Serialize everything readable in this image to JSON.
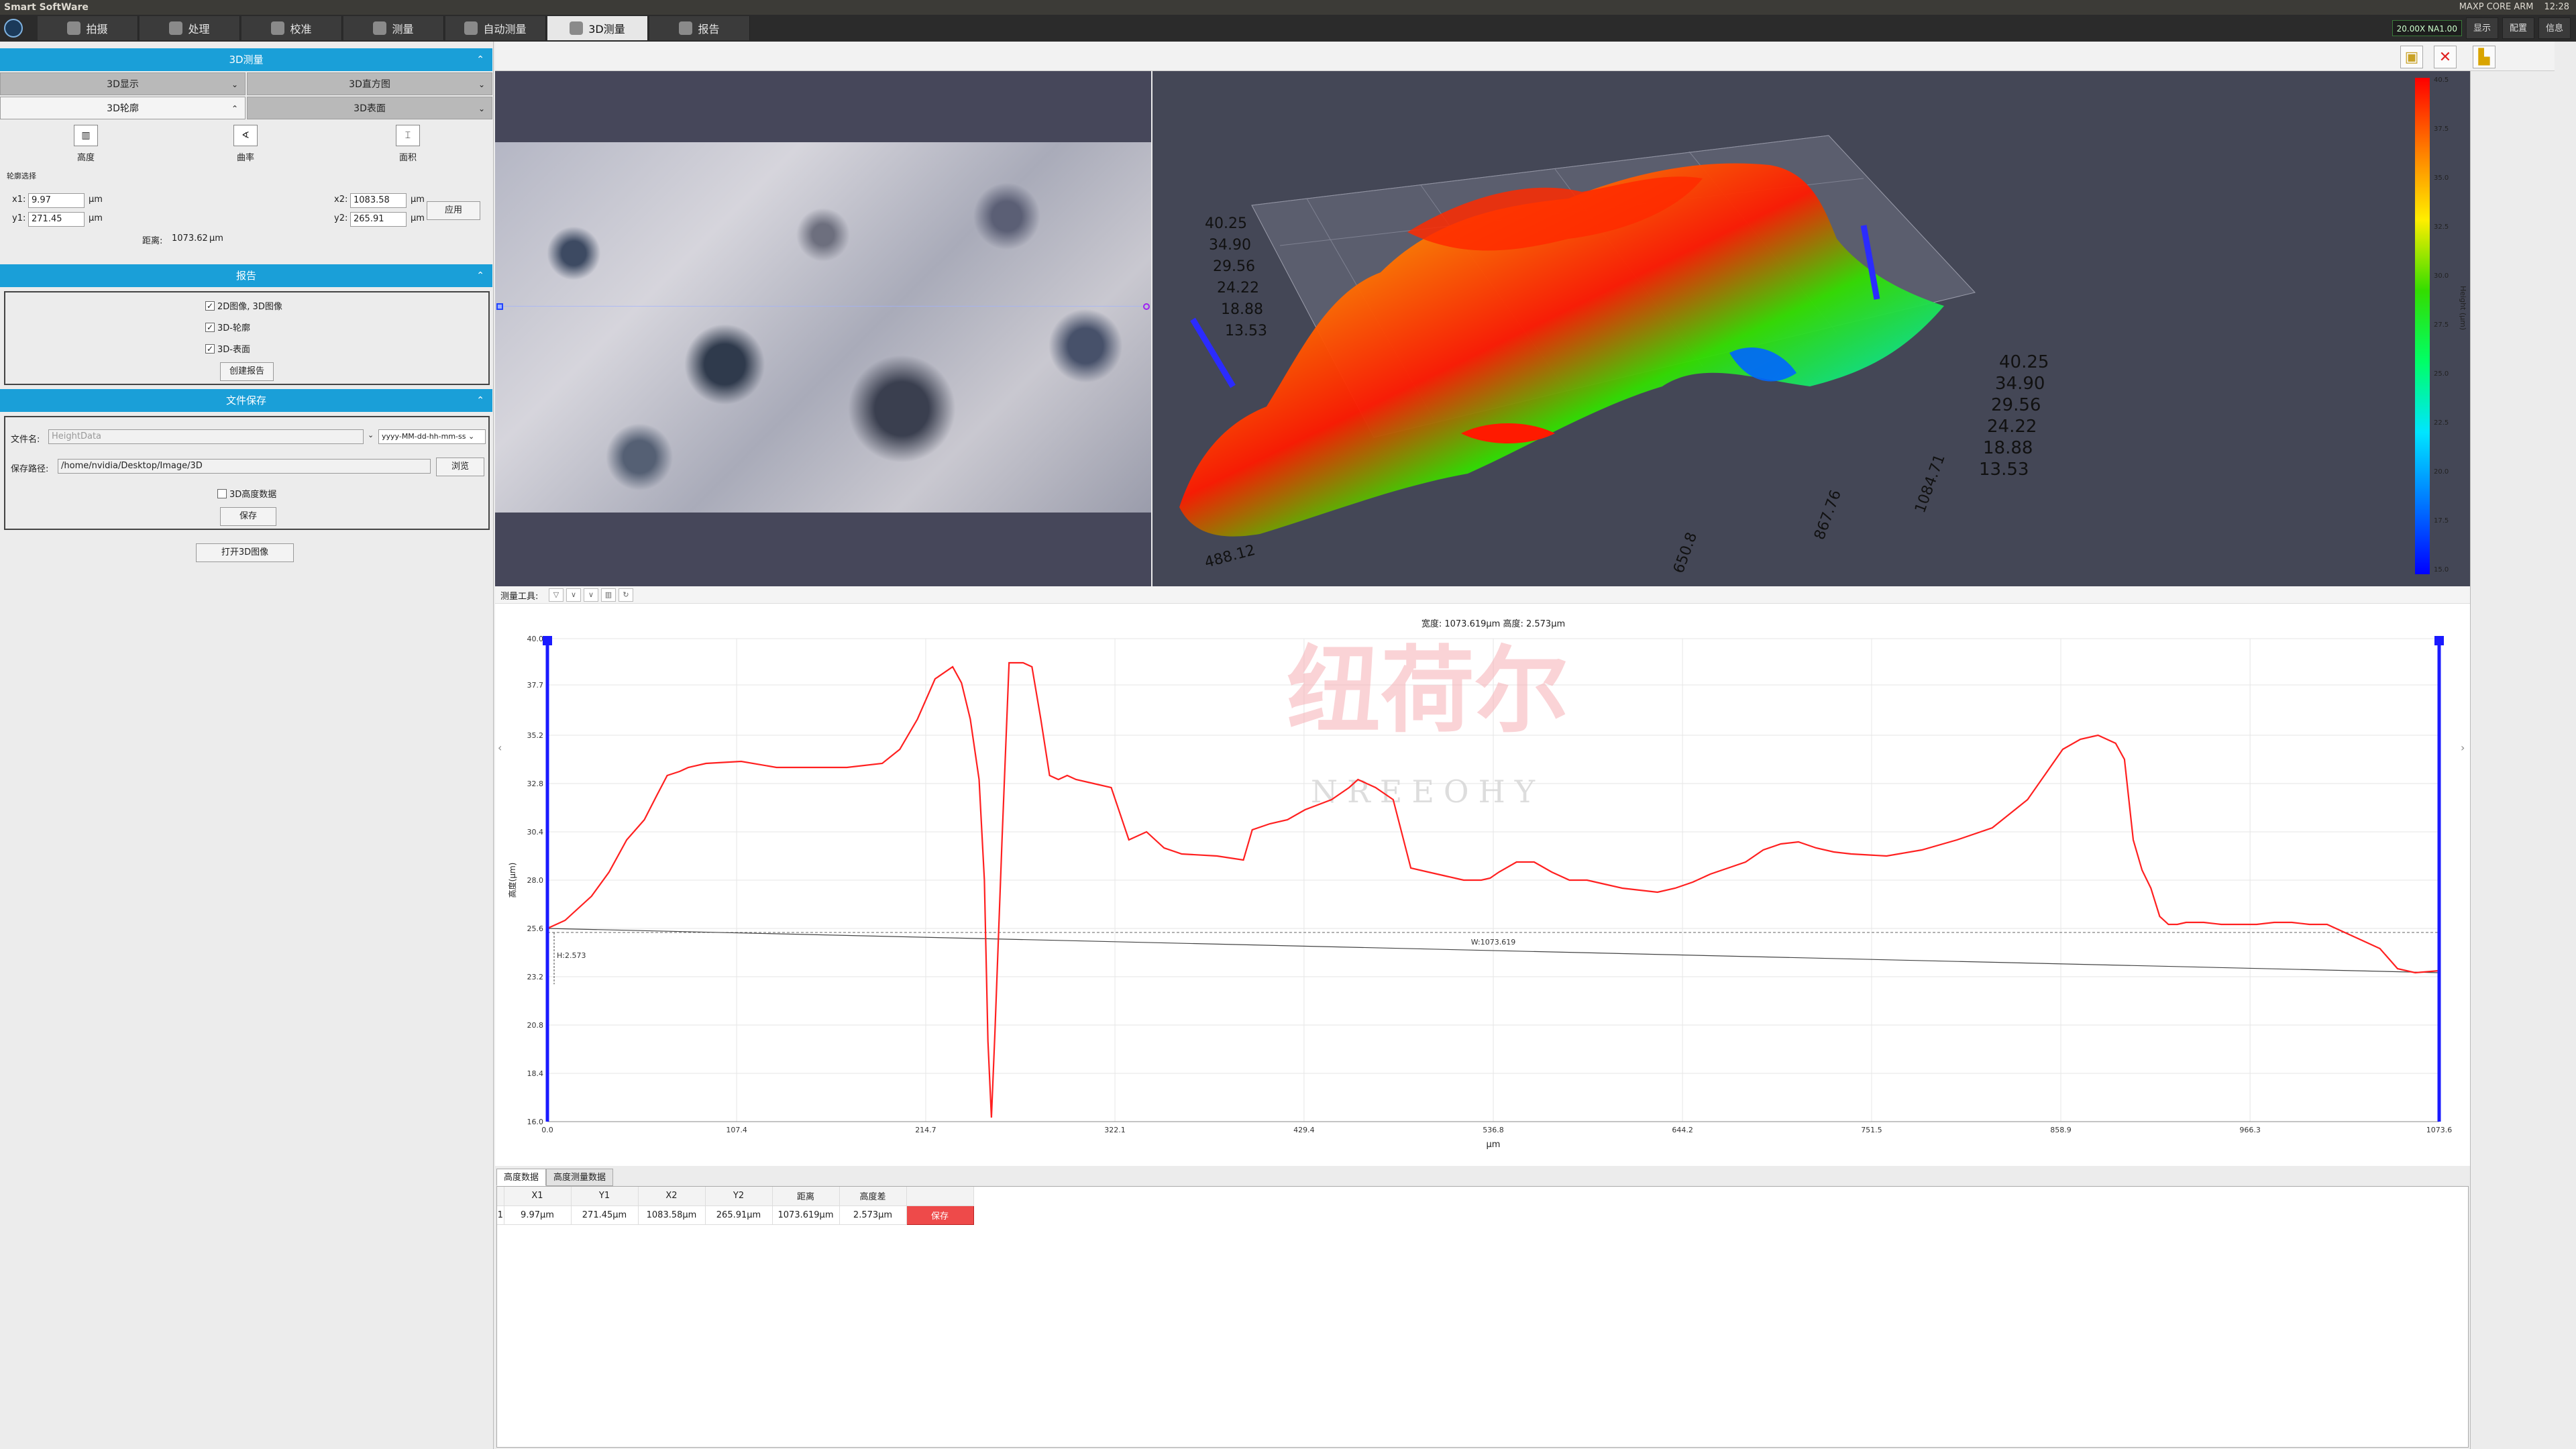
{
  "system_bar": {
    "app_title": "Smart SoftWare",
    "gpu_label": "MAXP CORE ARM",
    "time": "12:28"
  },
  "tabs": [
    {
      "label": "拍摄",
      "icon": "camera-icon"
    },
    {
      "label": "处理",
      "icon": "image-process-icon"
    },
    {
      "label": "校准",
      "icon": "calibrate-icon"
    },
    {
      "label": "测量",
      "icon": "measure-icon"
    },
    {
      "label": "自动测量",
      "icon": "auto-measure-icon"
    },
    {
      "label": "3D测量",
      "icon": "3d-measure-icon"
    },
    {
      "label": "报告",
      "icon": "report-icon"
    }
  ],
  "active_tab": "3D测量",
  "tab_right": {
    "zoom_badge": "20.00X",
    "zoom_badge_2": "NA1.00",
    "display_label": "显示",
    "config_label": "配置",
    "info_label": "信息"
  },
  "left": {
    "measure3d": {
      "header": "3D测量",
      "buttons": [
        "3D显示",
        "3D直方图",
        "3D轮廓",
        "3D表面"
      ],
      "tools": [
        {
          "label": "高度",
          "icon": "height-icon"
        },
        {
          "label": "曲率",
          "icon": "curvature-icon"
        },
        {
          "label": "面积",
          "icon": "area-icon"
        }
      ],
      "contour_select": "轮廓选择",
      "x1_label": "x1:",
      "x1_value": "9.97",
      "y1_label": "y1:",
      "y1_value": "271.45",
      "x2_label": "x2:",
      "x2_value": "1083.58",
      "y2_label": "y2:",
      "y2_value": "265.91",
      "unit": "µm",
      "apply_label": "应用",
      "distance_label": "距离:",
      "distance_value": "1073.62",
      "distance_unit": "µm"
    },
    "report": {
      "header": "报告",
      "checks": [
        {
          "label": "2D图像, 3D图像",
          "checked": true
        },
        {
          "label": "3D-轮廓",
          "checked": true
        },
        {
          "label": "3D-表面",
          "checked": true
        }
      ],
      "create_label": "创建报告"
    },
    "filesave": {
      "header": "文件保存",
      "filename_label": "文件名:",
      "filename_placeholder": "HeightData",
      "filename_format": "yyyy-MM-dd-hh-mm-ss",
      "path_label": "保存路径:",
      "path_value": "/home/nvidia/Desktop/Image/3D",
      "browse_label": "浏览",
      "height_data_label": "3D高度数据",
      "save_label": "保存"
    },
    "open_label": "打开3D图像"
  },
  "view3d": {
    "z_ticks_left": [
      "40.25",
      "34.90",
      "29.56",
      "24.22",
      "18.88",
      "13.53"
    ],
    "z_ticks_right": [
      "40.25",
      "34.90",
      "29.56",
      "24.22",
      "18.88",
      "13.53"
    ],
    "x_ticks": [
      "488.12",
      "650.8",
      "867.76",
      "1084.71"
    ],
    "colorbar": {
      "ticks": [
        "40.5",
        "37.5",
        "35.0",
        "32.5",
        "30.0",
        "27.5",
        "25.0",
        "22.5",
        "20.0",
        "17.5",
        "15.0"
      ],
      "label": "Height (µm)",
      "colors": [
        "#ff0000",
        "#ff7a00",
        "#ffee00",
        "#33dd00",
        "#00ff66",
        "#00e5ff",
        "#0077ff",
        "#0000ff"
      ]
    }
  },
  "measure_toolbar_label": "测量工具:",
  "chart_data": {
    "type": "line",
    "title": "宽度: 1073.619µm 高度: 2.573µm",
    "xlabel": "µm",
    "ylabel": "高度(µm)",
    "xlim": [
      0.0,
      1073.6
    ],
    "ylim": [
      16.0,
      40.0
    ],
    "x_ticks": [
      "0.0",
      "107.4",
      "214.7",
      "322.1",
      "429.4",
      "536.8",
      "644.2",
      "751.5",
      "858.9",
      "966.3",
      "1073.6"
    ],
    "y_ticks": [
      "16.0",
      "18.4",
      "20.8",
      "23.2",
      "25.6",
      "28.0",
      "30.4",
      "32.8",
      "35.2",
      "37.7",
      "40.0"
    ],
    "series": [
      {
        "color": "#ff2020",
        "x": [
          0,
          10,
          25,
          35,
          45,
          55,
          62,
          68,
          75,
          80,
          90,
          110,
          130,
          150,
          170,
          190,
          200,
          210,
          220,
          230,
          235,
          240,
          245,
          248,
          250,
          252,
          254,
          258,
          262,
          266,
          270,
          275,
          280,
          285,
          290,
          295,
          300,
          310,
          320,
          330,
          340,
          350,
          360,
          380,
          395,
          400,
          410,
          420,
          430,
          445,
          455,
          460,
          470,
          480,
          490,
          500,
          510,
          520,
          530,
          535,
          540,
          550,
          560,
          570,
          580,
          590,
          600,
          610,
          620,
          630,
          640,
          650,
          660,
          680,
          690,
          700,
          710,
          720,
          730,
          740,
          760,
          780,
          800,
          820,
          840,
          860,
          870,
          880,
          890,
          895,
          900,
          905,
          910,
          915,
          920,
          925,
          930,
          940,
          950,
          960,
          970,
          980,
          990,
          1000,
          1010,
          1020,
          1030,
          1040,
          1050,
          1060,
          1073.6
        ],
        "y": [
          25.6,
          26.0,
          27.2,
          28.4,
          30.0,
          31.0,
          32.2,
          33.2,
          33.4,
          33.6,
          33.8,
          33.9,
          33.6,
          33.6,
          33.6,
          33.8,
          34.5,
          36.0,
          38.0,
          38.6,
          37.8,
          36.0,
          33.0,
          28.0,
          20.0,
          16.2,
          20.5,
          30.0,
          38.8,
          38.8,
          38.8,
          38.6,
          36.0,
          33.2,
          33.0,
          33.2,
          33.0,
          32.8,
          32.6,
          30.0,
          30.4,
          29.6,
          29.3,
          29.2,
          29.0,
          30.5,
          30.8,
          31.0,
          31.5,
          32.0,
          32.6,
          33.0,
          32.6,
          32.0,
          28.6,
          28.4,
          28.2,
          28.0,
          28.0,
          28.1,
          28.4,
          28.9,
          28.9,
          28.4,
          28.0,
          28.0,
          27.8,
          27.6,
          27.5,
          27.4,
          27.6,
          27.9,
          28.3,
          28.9,
          29.5,
          29.8,
          29.9,
          29.6,
          29.4,
          29.3,
          29.2,
          29.5,
          30.0,
          30.6,
          32.0,
          34.5,
          35.0,
          35.2,
          34.8,
          34.0,
          30.0,
          28.5,
          27.6,
          26.2,
          25.8,
          25.8,
          25.9,
          25.9,
          25.8,
          25.8,
          25.8,
          25.9,
          25.9,
          25.8,
          25.8,
          25.4,
          25.0,
          24.6,
          23.6,
          23.4,
          23.5
        ]
      }
    ],
    "baseline": {
      "x1": 0,
      "y1": 25.6,
      "x2": 1073.6,
      "y2": 23.4
    },
    "reference_level": 25.4,
    "annotation_height": "2.573",
    "annotation_width": "W:1073.619"
  },
  "bottom_tabs": [
    "高度数据",
    "高度测量数据"
  ],
  "table": {
    "headers": [
      "",
      "X1",
      "Y1",
      "X2",
      "Y2",
      "距离",
      "高度差",
      ""
    ],
    "rows": [
      [
        "1",
        "9.97µm",
        "271.45µm",
        "1083.58µm",
        "265.91µm",
        "1073.619µm",
        "2.573µm",
        "保存"
      ]
    ]
  },
  "watermark": {
    "cn": "纽荷尔",
    "en": "NREEOHY"
  }
}
